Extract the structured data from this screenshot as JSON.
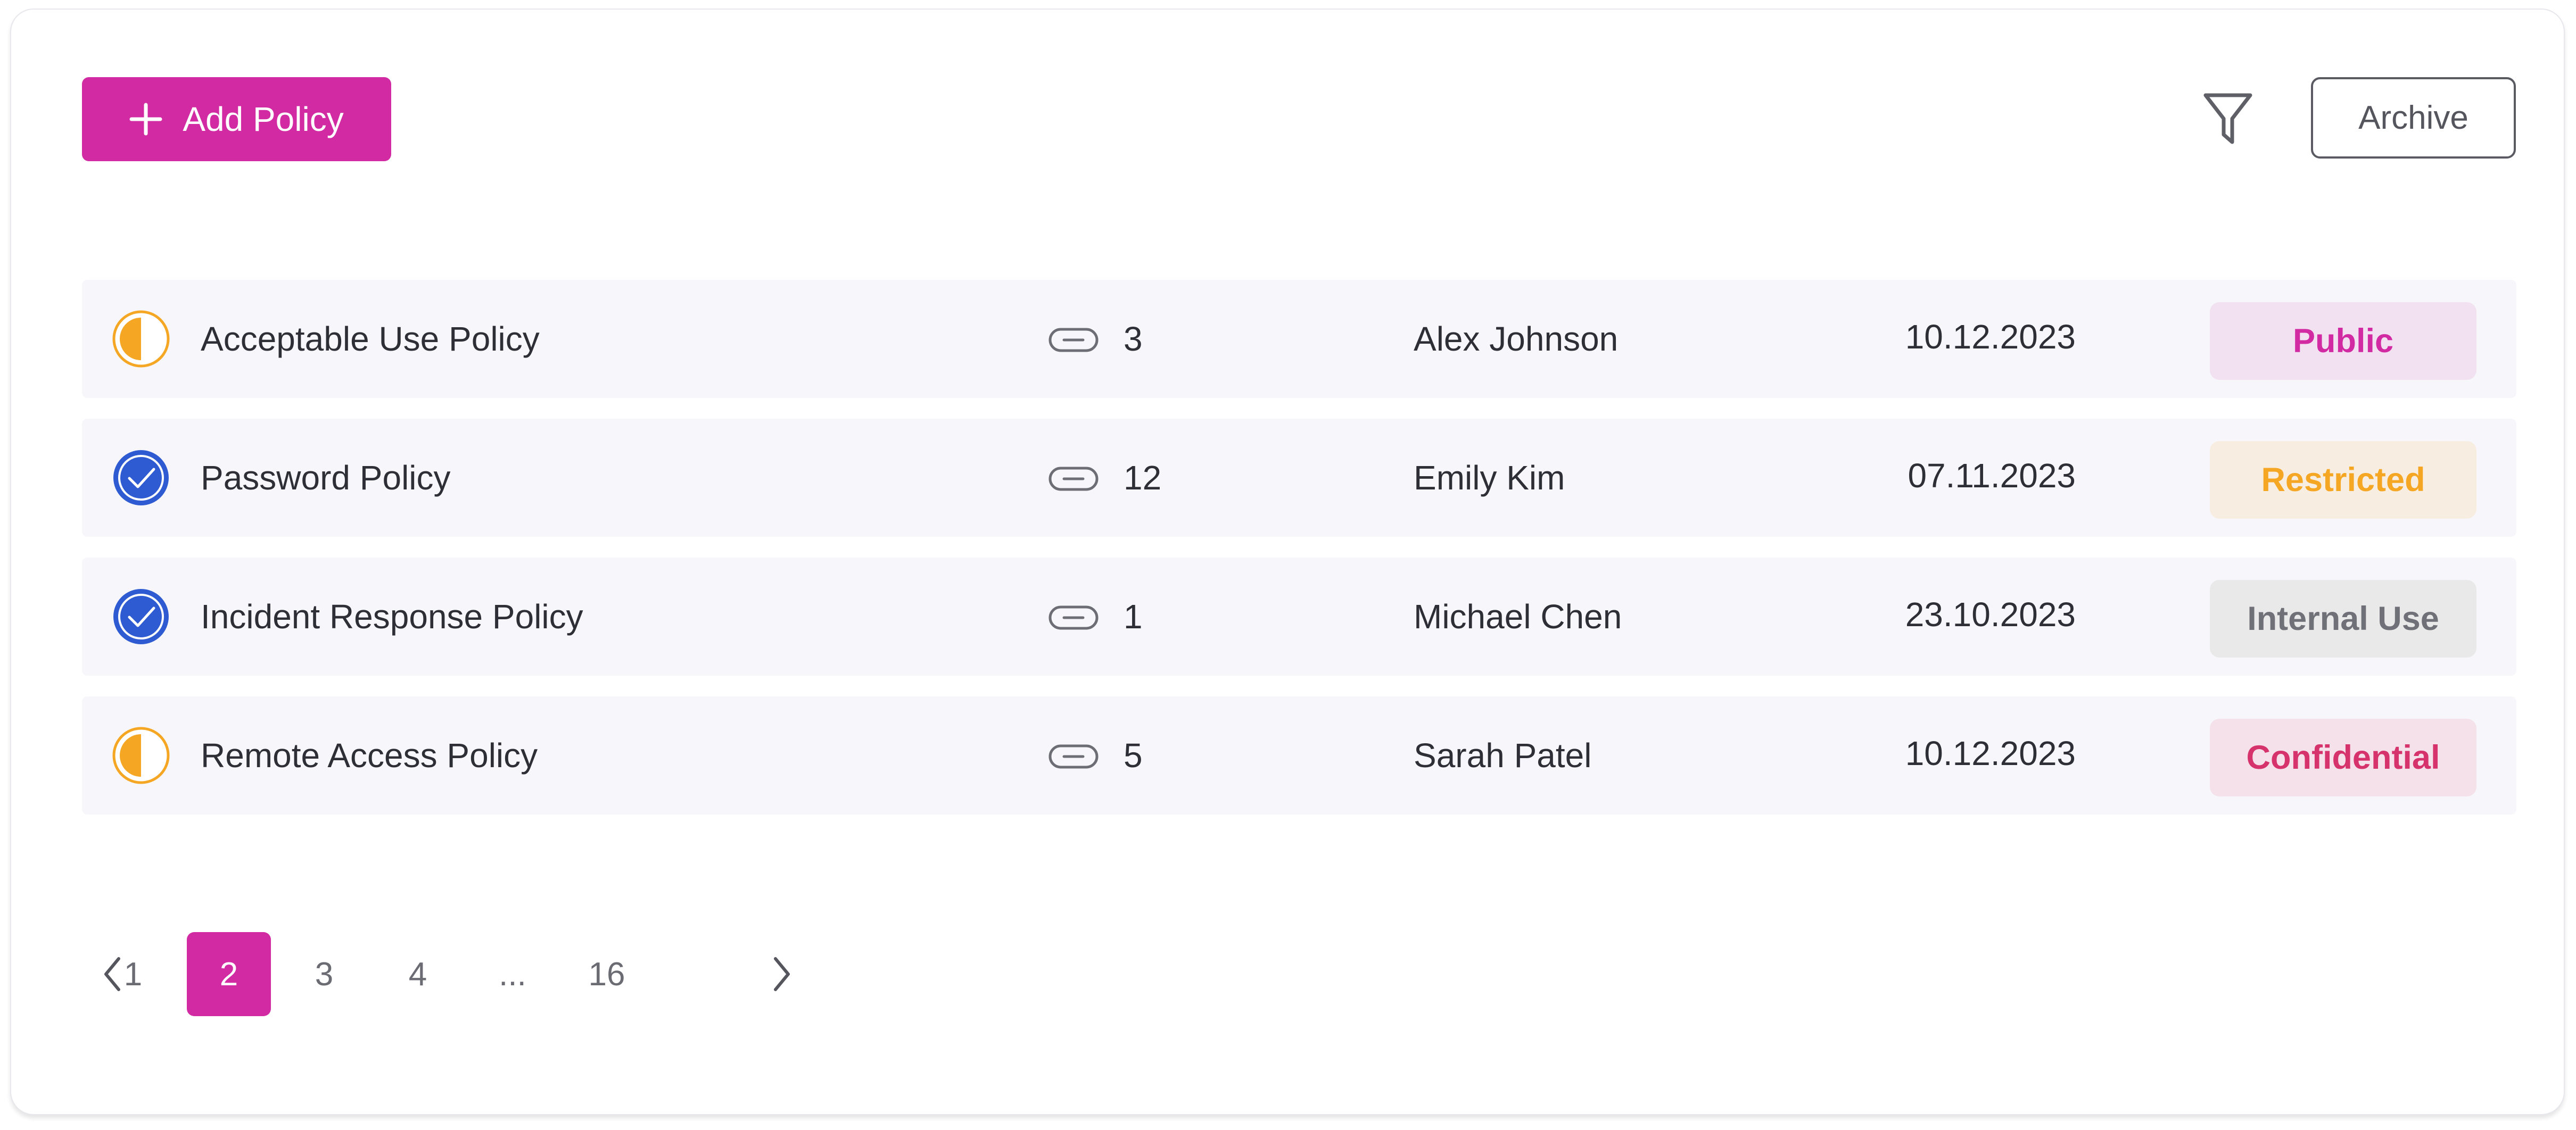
{
  "toolbar": {
    "add_label": "Add Policy",
    "archive_label": "Archive",
    "add_icon": "plus-icon",
    "filter_icon": "filter-icon"
  },
  "colors": {
    "accent": "#d22aa3",
    "in_progress": "#f5a623",
    "completed": "#2e5bd1"
  },
  "policies": [
    {
      "status": "in-progress",
      "status_icon": "half-circle-icon",
      "name": "Acceptable Use Policy",
      "link_icon": "link-icon",
      "links": "3",
      "owner": "Alex Johnson",
      "date": "10.12.2023",
      "classification": "Public"
    },
    {
      "status": "completed",
      "status_icon": "check-circle-icon",
      "name": "Password Policy",
      "link_icon": "link-icon",
      "links": "12",
      "owner": "Emily Kim",
      "date": "07.11.2023",
      "classification": "Restricted"
    },
    {
      "status": "completed",
      "status_icon": "check-circle-icon",
      "name": "Incident Response Policy",
      "link_icon": "link-icon",
      "links": "1",
      "owner": "Michael Chen",
      "date": "23.10.2023",
      "classification": "Internal Use"
    },
    {
      "status": "in-progress",
      "status_icon": "half-circle-icon",
      "name": "Remote Access Policy",
      "link_icon": "link-icon",
      "links": "5",
      "owner": "Sarah Patel",
      "date": "10.12.2023",
      "classification": "Confidential"
    }
  ],
  "badge_colors": {
    "Public": {
      "bg": "#f2e2f1",
      "fg": "#d22aa3"
    },
    "Restricted": {
      "bg": "#f8ede1",
      "fg": "#f5a623"
    },
    "Internal Use": {
      "bg": "#e9e9ea",
      "fg": "#707078"
    },
    "Confidential": {
      "bg": "#f5e1ea",
      "fg": "#d6336c"
    }
  },
  "pagination": {
    "prev_icon": "chevron-left-icon",
    "next_icon": "chevron-right-icon",
    "pages": [
      "1",
      "2",
      "3",
      "4",
      "...",
      "16"
    ],
    "current": "2"
  }
}
